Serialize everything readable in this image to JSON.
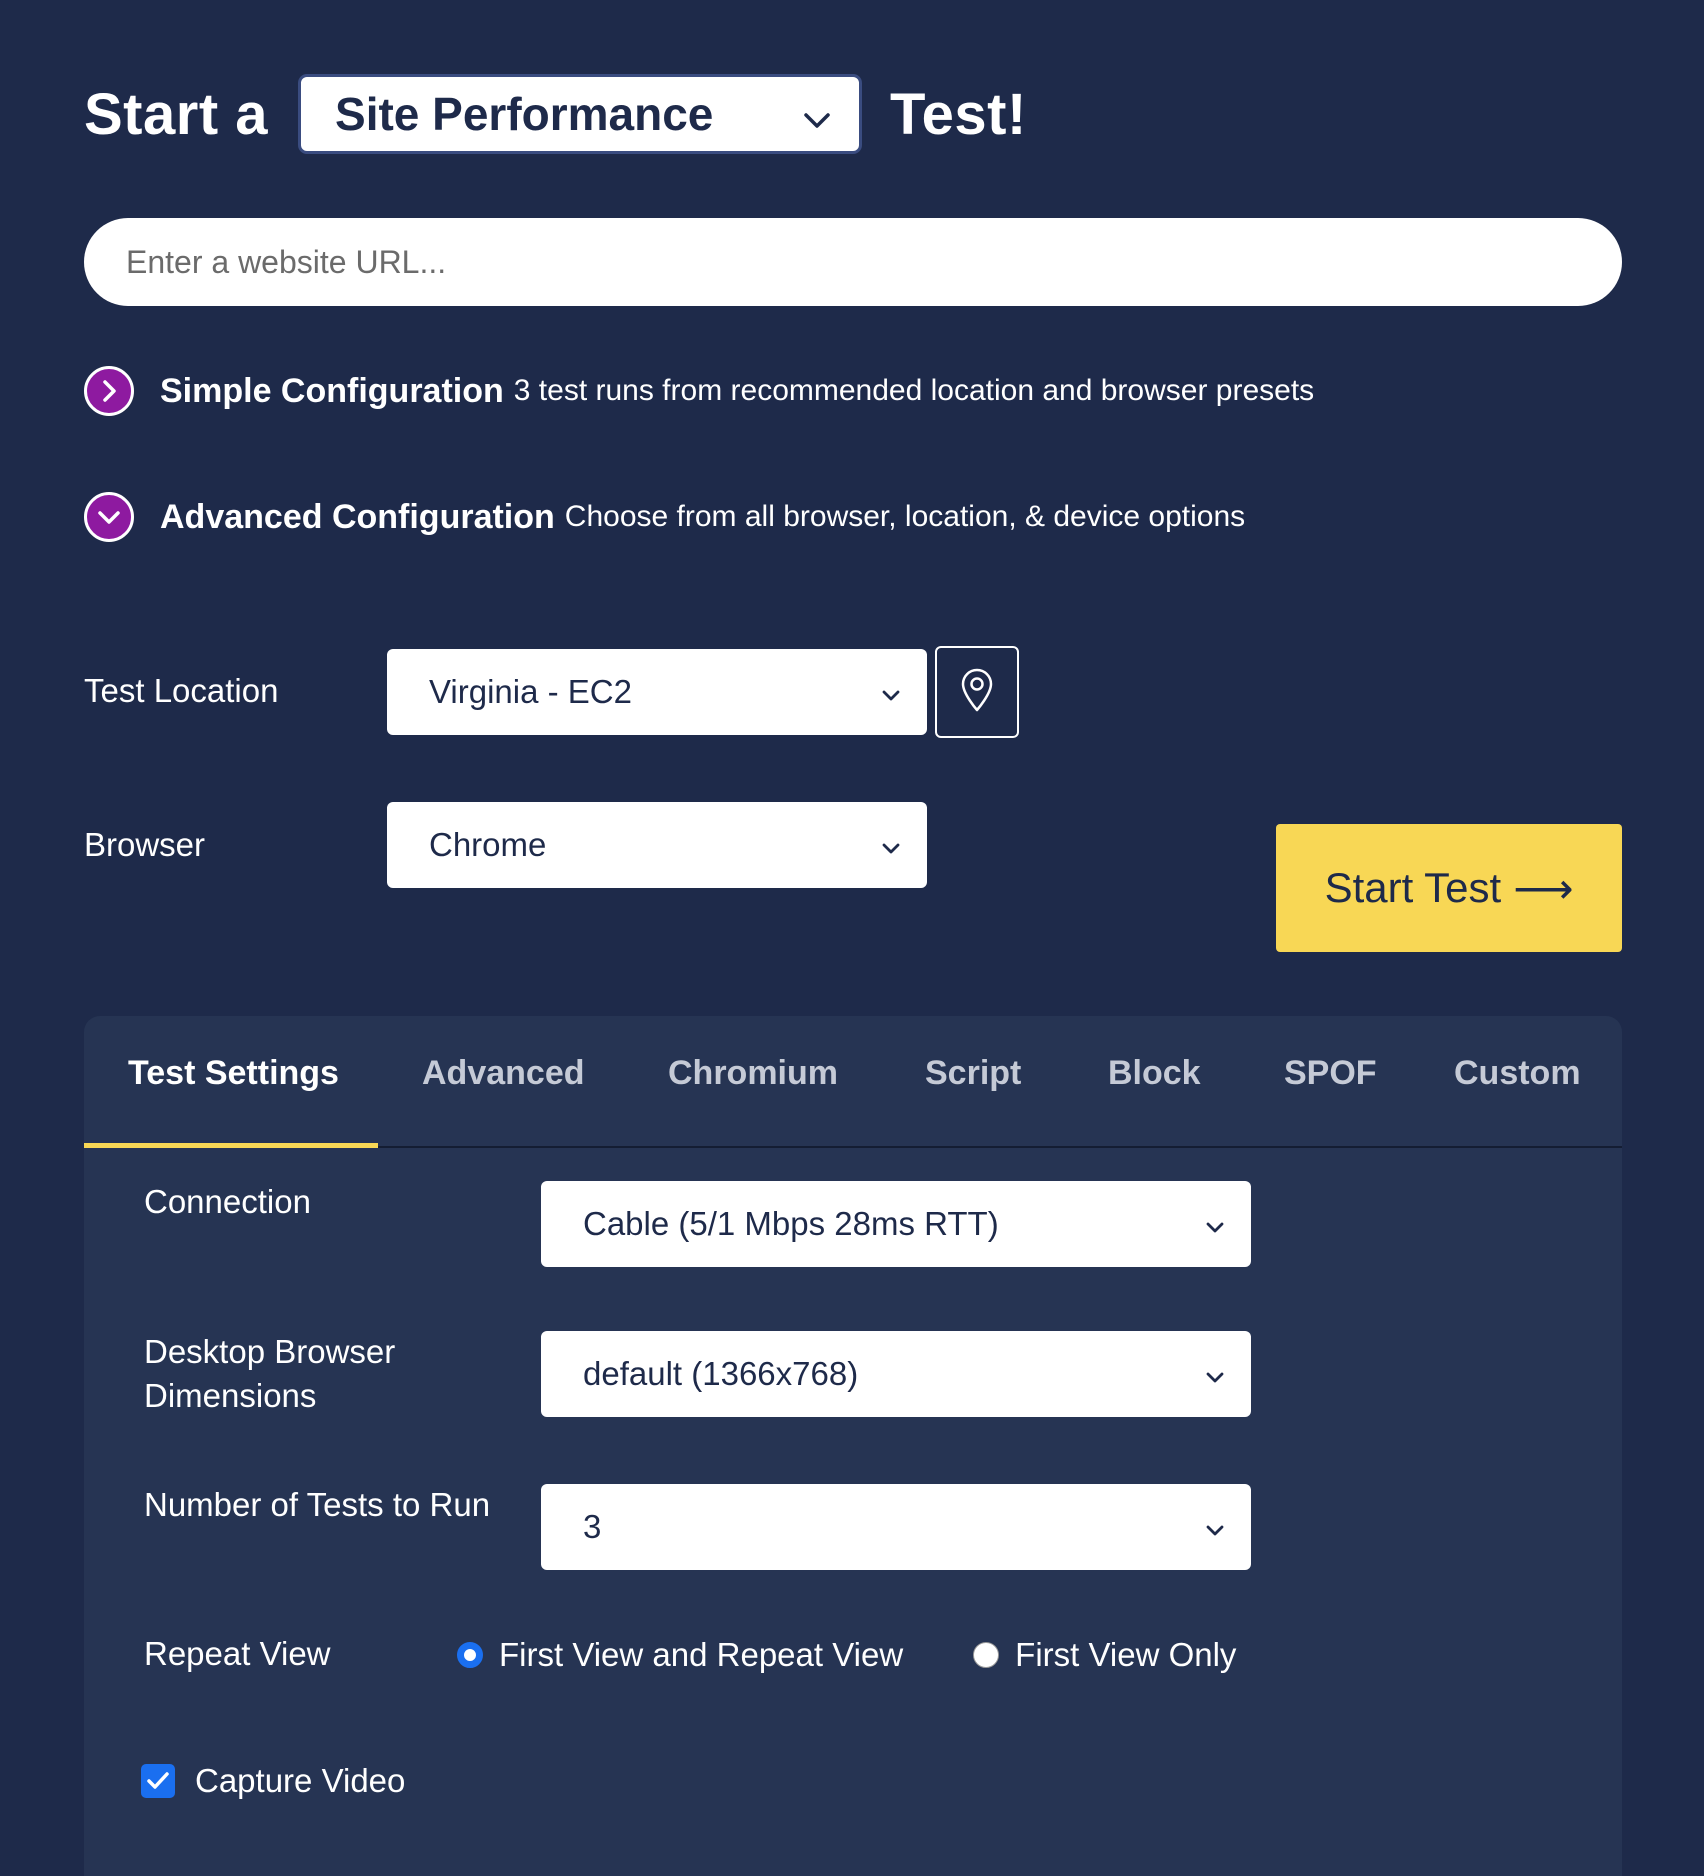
{
  "header": {
    "prefix": "Start a",
    "suffix": "Test!",
    "test_type": "Site Performance"
  },
  "url_input": {
    "placeholder": "Enter a website URL...",
    "value": ""
  },
  "config": {
    "simple": {
      "title": "Simple Configuration",
      "description": "3 test runs from recommended location and browser presets",
      "icon": "chevron-right-icon",
      "expanded": false
    },
    "advanced": {
      "title": "Advanced Configuration",
      "description": "Choose from all browser, location, & device options",
      "icon": "chevron-down-icon",
      "expanded": true
    }
  },
  "location": {
    "label": "Test Location",
    "value": "Virginia - EC2",
    "map_icon": "map-pin-icon"
  },
  "browser": {
    "label": "Browser",
    "value": "Chrome"
  },
  "start_button": {
    "label": "Start Test",
    "arrow": "⟶"
  },
  "tabs": [
    {
      "label": "Test Settings",
      "active": true
    },
    {
      "label": "Advanced",
      "active": false
    },
    {
      "label": "Chromium",
      "active": false
    },
    {
      "label": "Script",
      "active": false
    },
    {
      "label": "Block",
      "active": false
    },
    {
      "label": "SPOF",
      "active": false
    },
    {
      "label": "Custom",
      "active": false
    }
  ],
  "settings": {
    "connection": {
      "label": "Connection",
      "value": "Cable (5/1 Mbps 28ms RTT)"
    },
    "dimensions": {
      "label_line1": "Desktop Browser",
      "label_line2": "Dimensions",
      "value": "default (1366x768)"
    },
    "num_tests": {
      "label": "Number of Tests to Run",
      "value": "3"
    },
    "repeat_view": {
      "label": "Repeat View",
      "options": [
        {
          "label": "First View and Repeat View",
          "checked": true
        },
        {
          "label": "First View Only",
          "checked": false
        }
      ]
    },
    "capture_video": {
      "label": "Capture Video",
      "checked": true
    }
  },
  "colors": {
    "background": "#1e2a4a",
    "panel": "#263453",
    "accent_yellow": "#f8d755",
    "toggle_purple": "#8e1aa0",
    "control_blue": "#1a6ff0"
  }
}
